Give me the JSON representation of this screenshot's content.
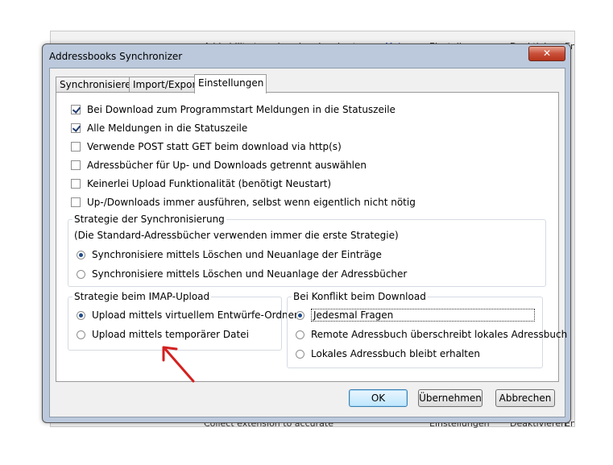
{
  "background": {
    "top_row": {
      "c1": "Add ability to reduce header size to on",
      "c2": "Mehr",
      "c3": "Einstellungen",
      "c4": "Deaktivieren",
      "c5": "Entferne"
    },
    "bottom_row": {
      "c1": "Collect extension to accurate",
      "c2": "",
      "c3": "Einstellungen",
      "c4": "Deaktivieren",
      "c5": "Entfern"
    }
  },
  "dialog": {
    "title": "Addressbooks Synchronizer",
    "close_glyph": "✕"
  },
  "tabs": [
    {
      "label": "Synchronisieren",
      "active": false
    },
    {
      "label": "Import/Export",
      "active": false
    },
    {
      "label": "Einstellungen",
      "active": true
    }
  ],
  "options": [
    {
      "label": "Bei Download zum Programmstart Meldungen in die Statuszeile",
      "checked": true
    },
    {
      "label": "Alle Meldungen in die Statuszeile",
      "checked": true
    },
    {
      "label": "Verwende POST statt GET beim download via http(s)",
      "checked": false
    },
    {
      "label": "Adressbücher für Up- und Downloads getrennt auswählen",
      "checked": false
    },
    {
      "label": "Keinerlei Upload Funktionalität (benötigt Neustart)",
      "checked": false
    },
    {
      "label": "Up-/Downloads immer ausführen, selbst wenn eigentlich nicht nötig",
      "checked": false
    }
  ],
  "sync_strategy": {
    "title": "Strategie der Synchronisierung",
    "note": "(Die Standard-Adressbücher verwenden immer die erste Strategie)",
    "choices": [
      {
        "label": "Synchronisiere mittels Löschen und Neuanlage der Einträge",
        "selected": true
      },
      {
        "label": "Synchronisiere mittels Löschen und Neuanlage der Adressbücher",
        "selected": false
      }
    ]
  },
  "imap_strategy": {
    "title": "Strategie beim IMAP-Upload",
    "choices": [
      {
        "label": "Upload mittels virtuellem Entwürfe-Ordner",
        "selected": true
      },
      {
        "label": "Upload mittels temporärer Datei",
        "selected": false
      }
    ]
  },
  "conflict": {
    "title": "Bei Konflikt beim Download",
    "choices": [
      {
        "label": "Jedesmal Fragen",
        "selected": true
      },
      {
        "label": "Remote Adressbuch überschreibt lokales Adressbuch",
        "selected": false
      },
      {
        "label": "Lokales Adressbuch bleibt erhalten",
        "selected": false
      }
    ]
  },
  "buttons": {
    "ok": "OK",
    "apply": "Übernehmen",
    "cancel": "Abbrechen"
  },
  "colors": {
    "annotation_arrow": "#d42020",
    "frame": "#bcc9dc"
  }
}
